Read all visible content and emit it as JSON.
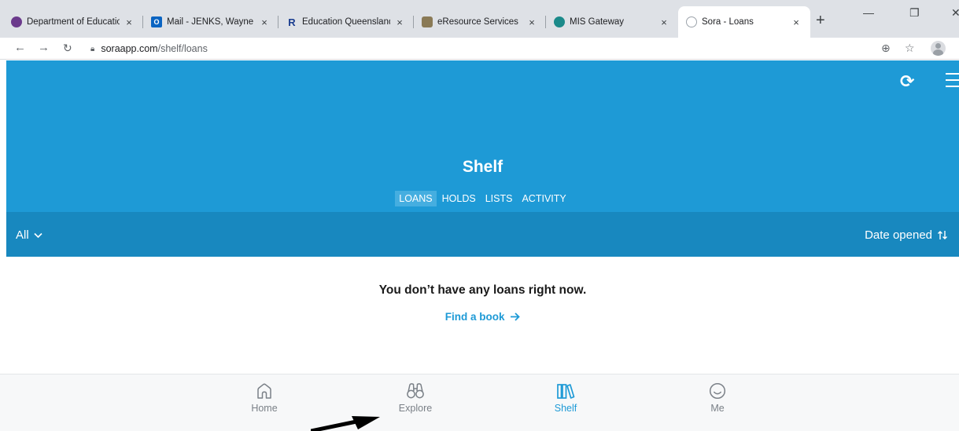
{
  "browser": {
    "tabs": [
      {
        "title": "Department of Education",
        "close": "×",
        "fav_color": "#6b3a8c",
        "fav_text": ""
      },
      {
        "title": "Mail - JENKS, Wayne",
        "close": "×",
        "fav_color": "#0a64c2",
        "fav_text": "O"
      },
      {
        "title": "Education Queensland",
        "close": "×",
        "fav_color": "#ffffff",
        "fav_text": "R"
      },
      {
        "title": "eResource Services",
        "close": "×",
        "fav_color": "#8a7a56",
        "fav_text": ""
      },
      {
        "title": "MIS Gateway",
        "close": "×",
        "fav_color": "#1b8a8a",
        "fav_text": ""
      },
      {
        "title": "Sora - Loans",
        "close": "×",
        "fav_color": "#9ca3ab",
        "fav_text": ""
      }
    ],
    "new_tab": "+",
    "window_minimize": "—",
    "window_restore": "❐",
    "window_close": "✕",
    "url_host": "soraapp.com",
    "url_path": "/shelf/loans"
  },
  "app": {
    "page_title": "Shelf",
    "tabs": [
      {
        "label": "LOANS",
        "active": true
      },
      {
        "label": "HOLDS",
        "active": false
      },
      {
        "label": "LISTS",
        "active": false
      },
      {
        "label": "ACTIVITY",
        "active": false
      }
    ],
    "filter_label": "All",
    "sort_label": "Date opened",
    "empty_message": "You don’t have any loans right now.",
    "find_link": "Find a book",
    "bottom_nav": [
      {
        "label": "Home",
        "active": false
      },
      {
        "label": "Explore",
        "active": false
      },
      {
        "label": "Shelf",
        "active": true
      },
      {
        "label": "Me",
        "active": false
      }
    ]
  },
  "colors": {
    "brand_blue": "#1e9ad6",
    "filter_bar": "#1888bf",
    "active_tab_bg": "#45aee0"
  }
}
